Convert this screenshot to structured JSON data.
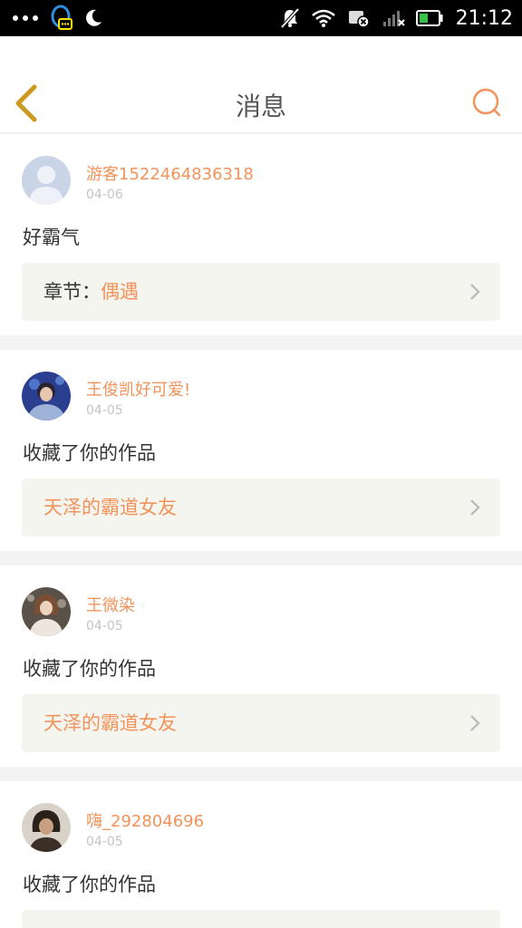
{
  "statusbar": {
    "time": "21:12",
    "icons": [
      "more-dots-icon",
      "qq-icon",
      "moon-icon",
      "notifications-off-icon",
      "wifi-icon",
      "sim-icon",
      "signal-icon",
      "battery-icon"
    ]
  },
  "header": {
    "title": "消息",
    "back_icon": "chevron-left-icon",
    "search_icon": "search-icon"
  },
  "colors": {
    "accent": "#f2935c",
    "back_icon": "#cc9a1e",
    "text": "#333333",
    "muted": "#c4c4c4",
    "box_bg": "#f5f5ef",
    "divider": "#f3f3f3"
  },
  "messages": [
    {
      "username": "游客1522464836318",
      "date": "04-06",
      "text": "好霸气",
      "box_label": "章节：",
      "box_value": "偶遇"
    },
    {
      "username": "王俊凯好可爱!",
      "date": "04-05",
      "text": "收藏了你的作品",
      "box_value": "天泽的霸道女友"
    },
    {
      "username": "王微染",
      "date": "04-05",
      "text": "收藏了你的作品",
      "box_value": "天泽的霸道女友"
    },
    {
      "username": "嗨_292804696",
      "date": "04-05",
      "text": "收藏了你的作品"
    }
  ]
}
